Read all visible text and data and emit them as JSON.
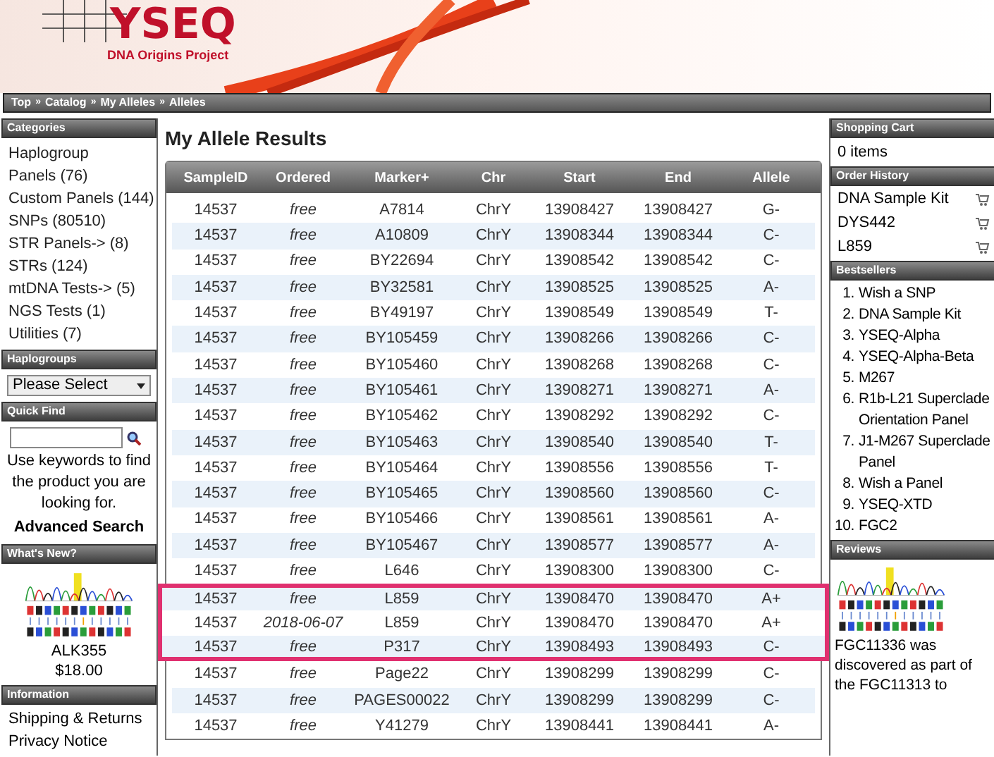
{
  "logo": {
    "name": "YSEQ",
    "tagline": "DNA Origins Project"
  },
  "breadcrumb": [
    "Top",
    "Catalog",
    "My Alleles",
    "Alleles"
  ],
  "breadcrumb_separator": "»",
  "left_sidebar": {
    "categories": {
      "title": "Categories",
      "items": [
        "Haplogroup",
        "Panels (76)",
        "Custom Panels (144)",
        "SNPs (80510)",
        "STR Panels-> (8)",
        "STRs (124)",
        "mtDNA Tests-> (5)",
        "NGS Tests (1)",
        "Utilities (7)"
      ]
    },
    "haplogroups": {
      "title": "Haplogroups",
      "select": "Please Select"
    },
    "quick_find": {
      "title": "Quick Find",
      "hint": "Use keywords to find the product you are looking for.",
      "advanced": "Advanced Search"
    },
    "whats_new": {
      "title": "What's New?",
      "product": "ALK355",
      "price": "$18.00"
    },
    "information": {
      "title": "Information",
      "items": [
        "Shipping & Returns",
        "Privacy Notice"
      ]
    }
  },
  "main": {
    "title": "My Allele Results",
    "table": {
      "columns": [
        "SampleID",
        "Ordered",
        "Marker+",
        "Chr",
        "Start",
        "End",
        "Allele"
      ],
      "rows": [
        {
          "cells": [
            "14537",
            "free",
            "A7814",
            "ChrY",
            "13908427",
            "13908427",
            "G-"
          ],
          "highlighted": false
        },
        {
          "cells": [
            "14537",
            "free",
            "A10809",
            "ChrY",
            "13908344",
            "13908344",
            "C-"
          ],
          "highlighted": false
        },
        {
          "cells": [
            "14537",
            "free",
            "BY22694",
            "ChrY",
            "13908542",
            "13908542",
            "C-"
          ],
          "highlighted": false
        },
        {
          "cells": [
            "14537",
            "free",
            "BY32581",
            "ChrY",
            "13908525",
            "13908525",
            "A-"
          ],
          "highlighted": false
        },
        {
          "cells": [
            "14537",
            "free",
            "BY49197",
            "ChrY",
            "13908549",
            "13908549",
            "T-"
          ],
          "highlighted": false
        },
        {
          "cells": [
            "14537",
            "free",
            "BY105459",
            "ChrY",
            "13908266",
            "13908266",
            "C-"
          ],
          "highlighted": false
        },
        {
          "cells": [
            "14537",
            "free",
            "BY105460",
            "ChrY",
            "13908268",
            "13908268",
            "C-"
          ],
          "highlighted": false
        },
        {
          "cells": [
            "14537",
            "free",
            "BY105461",
            "ChrY",
            "13908271",
            "13908271",
            "A-"
          ],
          "highlighted": false
        },
        {
          "cells": [
            "14537",
            "free",
            "BY105462",
            "ChrY",
            "13908292",
            "13908292",
            "C-"
          ],
          "highlighted": false
        },
        {
          "cells": [
            "14537",
            "free",
            "BY105463",
            "ChrY",
            "13908540",
            "13908540",
            "T-"
          ],
          "highlighted": false
        },
        {
          "cells": [
            "14537",
            "free",
            "BY105464",
            "ChrY",
            "13908556",
            "13908556",
            "T-"
          ],
          "highlighted": false
        },
        {
          "cells": [
            "14537",
            "free",
            "BY105465",
            "ChrY",
            "13908560",
            "13908560",
            "C-"
          ],
          "highlighted": false
        },
        {
          "cells": [
            "14537",
            "free",
            "BY105466",
            "ChrY",
            "13908561",
            "13908561",
            "A-"
          ],
          "highlighted": false
        },
        {
          "cells": [
            "14537",
            "free",
            "BY105467",
            "ChrY",
            "13908577",
            "13908577",
            "A-"
          ],
          "highlighted": false
        },
        {
          "cells": [
            "14537",
            "free",
            "L646",
            "ChrY",
            "13908300",
            "13908300",
            "C-"
          ],
          "highlighted": false
        },
        {
          "cells": [
            "14537",
            "free",
            "L859",
            "ChrY",
            "13908470",
            "13908470",
            "A+"
          ],
          "highlighted": true
        },
        {
          "cells": [
            "14537",
            "2018-06-07",
            "L859",
            "ChrY",
            "13908470",
            "13908470",
            "A+"
          ],
          "highlighted": true
        },
        {
          "cells": [
            "14537",
            "free",
            "P317",
            "ChrY",
            "13908493",
            "13908493",
            "C-"
          ],
          "highlighted": true
        },
        {
          "cells": [
            "14537",
            "free",
            "Page22",
            "ChrY",
            "13908299",
            "13908299",
            "C-"
          ],
          "highlighted": false
        },
        {
          "cells": [
            "14537",
            "free",
            "PAGES00022",
            "ChrY",
            "13908299",
            "13908299",
            "C-"
          ],
          "highlighted": false
        },
        {
          "cells": [
            "14537",
            "free",
            "Y41279",
            "ChrY",
            "13908441",
            "13908441",
            "A-"
          ],
          "highlighted": false
        }
      ]
    }
  },
  "right_sidebar": {
    "shopping_cart": {
      "title": "Shopping Cart",
      "text": "0 items"
    },
    "order_history": {
      "title": "Order History",
      "items": [
        "DNA Sample Kit",
        "DYS442",
        "L859"
      ]
    },
    "bestsellers": {
      "title": "Bestsellers",
      "items": [
        {
          "number": "1.",
          "name": "Wish a SNP"
        },
        {
          "number": "2.",
          "name": "DNA Sample Kit"
        },
        {
          "number": "3.",
          "name": "YSEQ-Alpha"
        },
        {
          "number": "4.",
          "name": "YSEQ-Alpha-Beta"
        },
        {
          "number": "5.",
          "name": "M267"
        },
        {
          "number": "6.",
          "name": "R1b-L21 Superclade Orientation Panel"
        },
        {
          "number": "7.",
          "name": "J1-M267 Superclade Panel"
        },
        {
          "number": "8.",
          "name": "Wish a Panel"
        },
        {
          "number": "9.",
          "name": "YSEQ-XTD"
        },
        {
          "number": "10.",
          "name": "FGC2"
        }
      ]
    },
    "reviews": {
      "title": "Reviews",
      "text": "FGC11336 was discovered as part of the FGC11313 to"
    }
  }
}
